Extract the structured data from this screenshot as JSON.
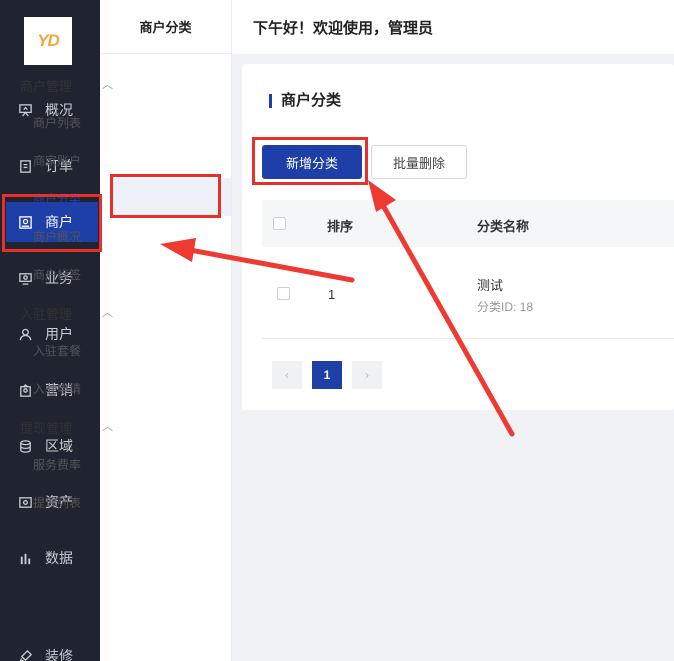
{
  "logo_text": "YD",
  "nav": [
    {
      "label": "概况",
      "icon": "presentation-icon"
    },
    {
      "label": "订单",
      "icon": "document-icon"
    },
    {
      "label": "商户",
      "icon": "merchant-icon"
    },
    {
      "label": "业务",
      "icon": "monitor-icon"
    },
    {
      "label": "用户",
      "icon": "user-icon"
    },
    {
      "label": "营销",
      "icon": "gift-icon"
    },
    {
      "label": "区域",
      "icon": "database-icon"
    },
    {
      "label": "资产",
      "icon": "wallet-icon"
    },
    {
      "label": "数据",
      "icon": "bar-chart-icon"
    },
    {
      "label": "装修",
      "icon": "brush-icon"
    }
  ],
  "sub": {
    "title": "商户分类",
    "groups": [
      {
        "label": "商户管理",
        "items": [
          "商户列表",
          "商家账户",
          "商户分类",
          "商户概况",
          "商户标签"
        ]
      },
      {
        "label": "入驻管理",
        "items": [
          "入驻套餐",
          "入驻申请"
        ]
      },
      {
        "label": "提现管理",
        "items": [
          "服务费率",
          "提现列表"
        ]
      }
    ]
  },
  "header": {
    "greeting": "下午好！欢迎使用，管理员"
  },
  "main": {
    "title": "商户分类",
    "add_button": "新增分类",
    "batch_delete_button": "批量删除",
    "columns": [
      "排序",
      "分类名称"
    ],
    "rows": [
      {
        "sort": "1",
        "name": "测试",
        "sub": "分类ID: 18"
      }
    ],
    "pagination": {
      "prev": "‹",
      "current": "1",
      "next": "›"
    }
  },
  "colors": {
    "primary": "#1e3fa8",
    "nav_bg": "#1f2430",
    "highlight": "#e8302a"
  }
}
